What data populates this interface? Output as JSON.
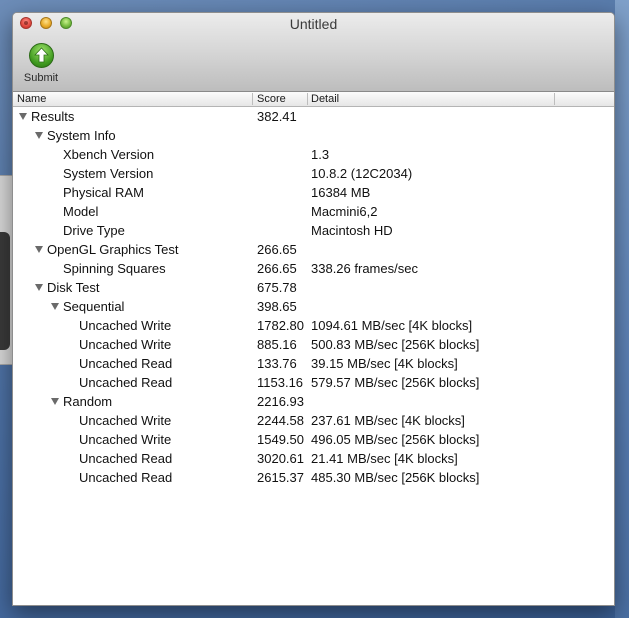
{
  "window": {
    "title": "Untitled"
  },
  "toolbar": {
    "submit_label": "Submit",
    "submit_icon": "upload-arrow-icon"
  },
  "columns": {
    "name": "Name",
    "score": "Score",
    "detail": "Detail"
  },
  "rows": [
    {
      "name": "Results",
      "score": "382.41",
      "detail": "",
      "depth": 0,
      "expanded": true
    },
    {
      "name": "System Info",
      "score": "",
      "detail": "",
      "depth": 1,
      "expanded": true
    },
    {
      "name": "Xbench Version",
      "score": "",
      "detail": "1.3",
      "depth": 2
    },
    {
      "name": "System Version",
      "score": "",
      "detail": "10.8.2 (12C2034)",
      "depth": 2
    },
    {
      "name": "Physical RAM",
      "score": "",
      "detail": "16384 MB",
      "depth": 2
    },
    {
      "name": "Model",
      "score": "",
      "detail": "Macmini6,2",
      "depth": 2
    },
    {
      "name": "Drive Type",
      "score": "",
      "detail": "Macintosh HD",
      "depth": 2
    },
    {
      "name": "OpenGL Graphics Test",
      "score": "266.65",
      "detail": "",
      "depth": 1,
      "expanded": true
    },
    {
      "name": "Spinning Squares",
      "score": "266.65",
      "detail": "338.26 frames/sec",
      "depth": 2
    },
    {
      "name": "Disk Test",
      "score": "675.78",
      "detail": "",
      "depth": 1,
      "expanded": true
    },
    {
      "name": "Sequential",
      "score": "398.65",
      "detail": "",
      "depth": 2,
      "expanded": true
    },
    {
      "name": "Uncached Write",
      "score": "1782.80",
      "detail": "1094.61 MB/sec [4K blocks]",
      "depth": 3
    },
    {
      "name": "Uncached Write",
      "score": "885.16",
      "detail": "500.83 MB/sec [256K blocks]",
      "depth": 3
    },
    {
      "name": "Uncached Read",
      "score": "133.76",
      "detail": "39.15 MB/sec [4K blocks]",
      "depth": 3
    },
    {
      "name": "Uncached Read",
      "score": "1153.16",
      "detail": "579.57 MB/sec [256K blocks]",
      "depth": 3
    },
    {
      "name": "Random",
      "score": "2216.93",
      "detail": "",
      "depth": 2,
      "expanded": true
    },
    {
      "name": "Uncached Write",
      "score": "2244.58",
      "detail": "237.61 MB/sec [4K blocks]",
      "depth": 3
    },
    {
      "name": "Uncached Write",
      "score": "1549.50",
      "detail": "496.05 MB/sec [256K blocks]",
      "depth": 3
    },
    {
      "name": "Uncached Read",
      "score": "3020.61",
      "detail": "21.41 MB/sec [4K blocks]",
      "depth": 3
    },
    {
      "name": "Uncached Read",
      "score": "2615.37",
      "detail": "485.30 MB/sec [256K blocks]",
      "depth": 3
    }
  ]
}
